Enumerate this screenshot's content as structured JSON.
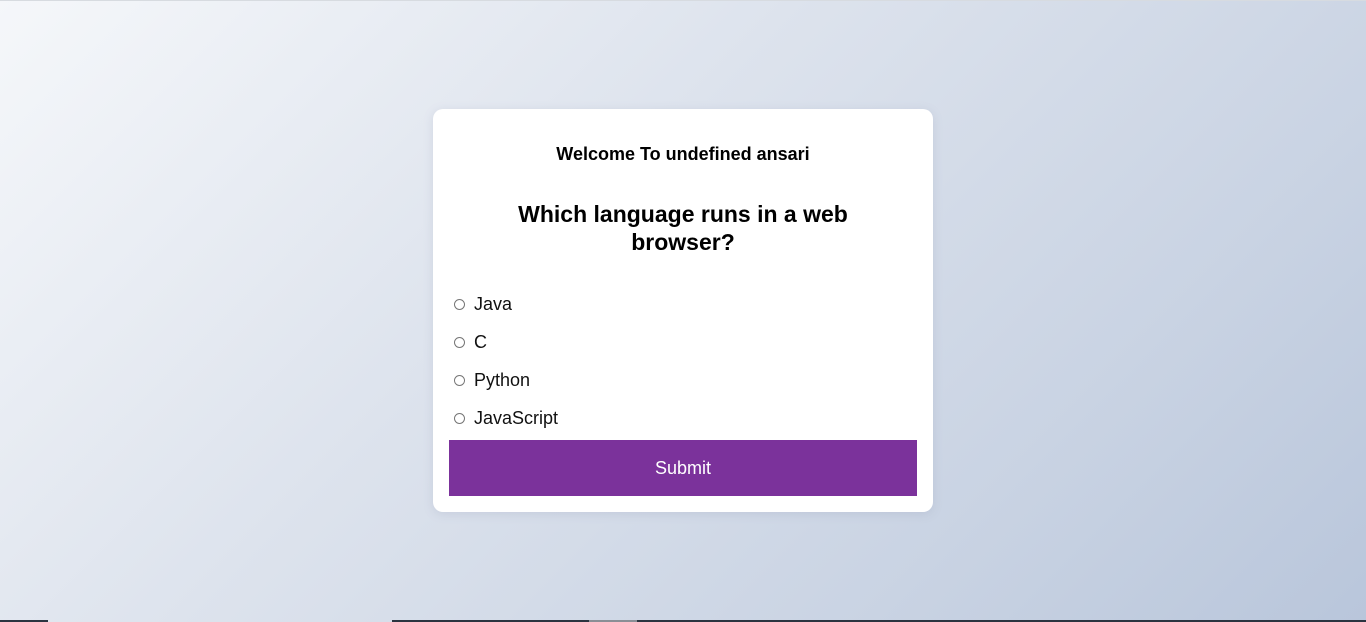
{
  "card": {
    "welcome": "Welcome To undefined ansari",
    "question": "Which language runs in a web browser?",
    "options": [
      {
        "label": "Java",
        "checked": false
      },
      {
        "label": "C",
        "checked": false
      },
      {
        "label": "Python",
        "checked": false
      },
      {
        "label": "JavaScript",
        "checked": false
      }
    ],
    "submit_label": "Submit"
  },
  "colors": {
    "accent": "#7b329b",
    "card_background": "#ffffff",
    "page_gradient_start": "#f5f7fa",
    "page_gradient_end": "#b9c6db"
  }
}
